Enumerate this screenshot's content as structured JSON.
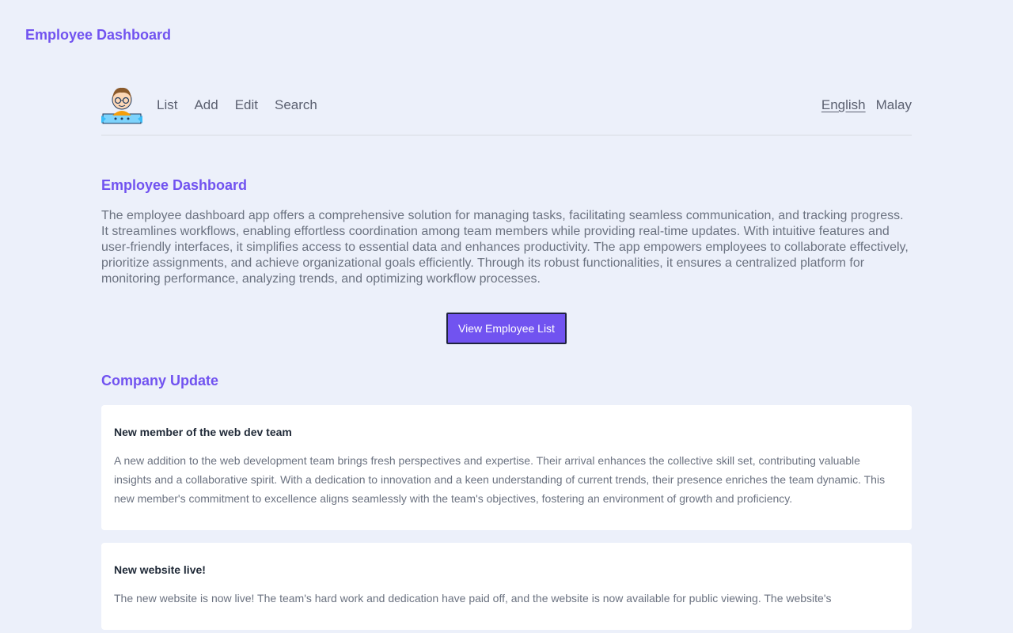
{
  "app": {
    "title": "Employee Dashboard"
  },
  "nav": {
    "links": [
      "List",
      "Add",
      "Edit",
      "Search"
    ],
    "languages": [
      "English",
      "Malay"
    ],
    "active_language": "English"
  },
  "intro": {
    "title": "Employee Dashboard",
    "text": "The employee dashboard app offers a comprehensive solution for managing tasks, facilitating seamless communication, and tracking progress. It streamlines workflows, enabling effortless coordination among team members while providing real-time updates. With intuitive features and user-friendly interfaces, it simplifies access to essential data and enhances productivity. The app empowers employees to collaborate effectively, prioritize assignments, and achieve organizational goals efficiently. Through its robust functionalities, it ensures a centralized platform for monitoring performance, analyzing trends, and optimizing workflow processes.",
    "button": "View Employee List"
  },
  "updates": {
    "title": "Company Update",
    "items": [
      {
        "title": "New member of the web dev team",
        "text": "A new addition to the web development team brings fresh perspectives and expertise. Their arrival enhances the collective skill set, contributing valuable insights and a collaborative spirit. With a dedication to innovation and a keen understanding of current trends, their presence enriches the team dynamic. This new member's commitment to excellence aligns seamlessly with the team's objectives, fostering an environment of growth and proficiency."
      },
      {
        "title": "New website live!",
        "text": "The new website is now live! The team's hard work and dedication have paid off, and the website is now available for public viewing. The website's"
      }
    ]
  },
  "colors": {
    "accent": "#7153f0",
    "background": "#ecf0fa",
    "card": "#ffffff"
  },
  "icons": {
    "avatar": "employee-avatar-icon"
  }
}
